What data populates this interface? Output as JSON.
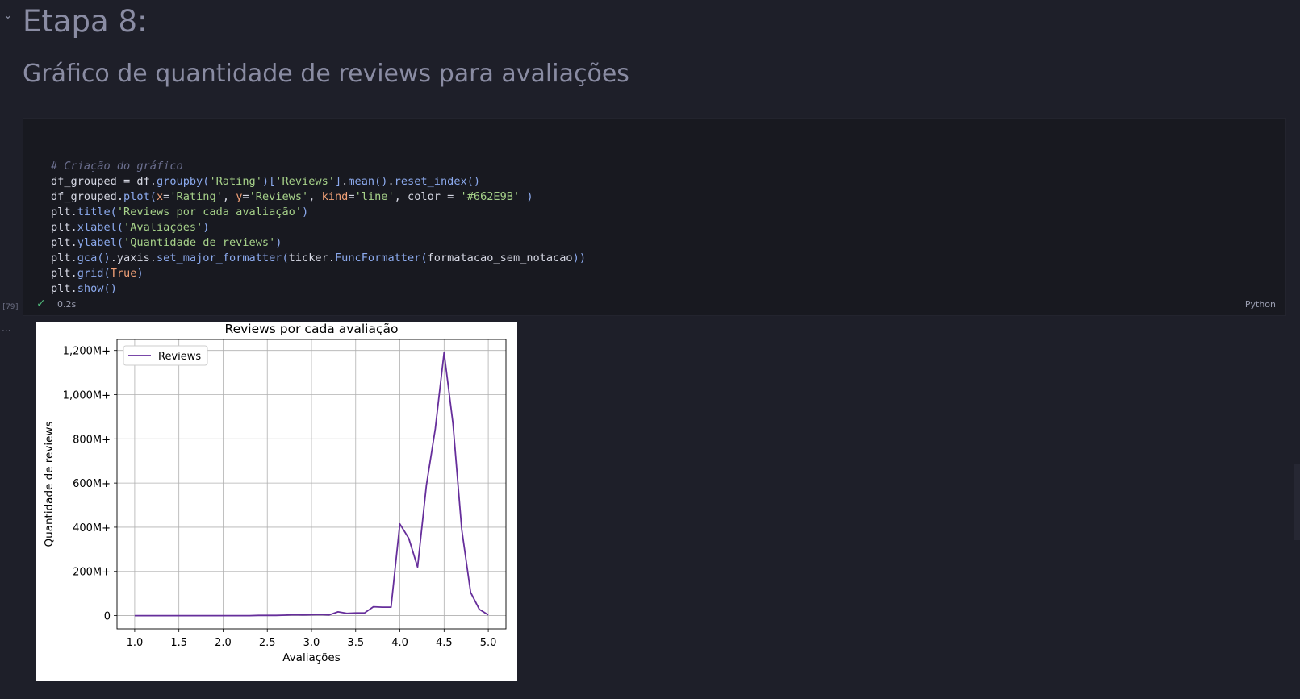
{
  "heading": "Etapa 8:",
  "subheading": "Gráfico de quantidade de reviews para avaliações",
  "cell": {
    "exec_count": "[79]",
    "status_time": "0.2s",
    "language": "Python",
    "code_lines": [
      "# Criação do gráfico",
      "df_grouped = df.groupby('Rating')['Reviews'].mean().reset_index()",
      "df_grouped.plot(x='Rating', y='Reviews', kind='line', color = '#662E9B' )",
      "plt.title('Reviews por cada avaliação')",
      "plt.xlabel('Avaliações')",
      "plt.ylabel('Quantidade de reviews')",
      "plt.gca().yaxis.set_major_formatter(ticker.FuncFormatter(formatacao_sem_notacao))",
      "plt.grid(True)",
      "plt.show()"
    ]
  },
  "output_more": "...",
  "chart_data": {
    "type": "line",
    "title": "Reviews por cada avaliação",
    "xlabel": "Avaliações",
    "ylabel": "Quantidade de reviews",
    "legend": "top-left",
    "grid": true,
    "color": "#662E9B",
    "xlim": [
      0.8,
      5.2
    ],
    "ylim": [
      -60000000,
      1250000000
    ],
    "x_ticks": [
      1.0,
      1.5,
      2.0,
      2.5,
      3.0,
      3.5,
      4.0,
      4.5,
      5.0
    ],
    "x_tick_labels": [
      "1.0",
      "1.5",
      "2.0",
      "2.5",
      "3.0",
      "3.5",
      "4.0",
      "4.5",
      "5.0"
    ],
    "y_ticks": [
      0,
      200000000,
      400000000,
      600000000,
      800000000,
      1000000000,
      1200000000
    ],
    "y_tick_labels": [
      "0",
      "200M+",
      "400M+",
      "600M+",
      "800M+",
      "1,000M+",
      "1,200M+"
    ],
    "series": [
      {
        "name": "Reviews",
        "x": [
          1.0,
          1.2,
          1.4,
          1.5,
          1.6,
          1.7,
          1.8,
          1.9,
          2.0,
          2.1,
          2.2,
          2.3,
          2.4,
          2.5,
          2.6,
          2.7,
          2.8,
          2.9,
          3.0,
          3.1,
          3.2,
          3.3,
          3.4,
          3.5,
          3.6,
          3.7,
          3.8,
          3.9,
          4.0,
          4.1,
          4.2,
          4.3,
          4.4,
          4.5,
          4.6,
          4.7,
          4.8,
          4.9,
          5.0
        ],
        "y": [
          0,
          0,
          0,
          0,
          0,
          0,
          0,
          0,
          0,
          0,
          0,
          0,
          1000000,
          1000000,
          1000000,
          2000000,
          4000000,
          3000000,
          4000000,
          5000000,
          3000000,
          17000000,
          10000000,
          12000000,
          12000000,
          40000000,
          38000000,
          38000000,
          415000000,
          350000000,
          220000000,
          590000000,
          845000000,
          1190000000,
          870000000,
          390000000,
          105000000,
          28000000,
          3000000
        ]
      }
    ]
  }
}
